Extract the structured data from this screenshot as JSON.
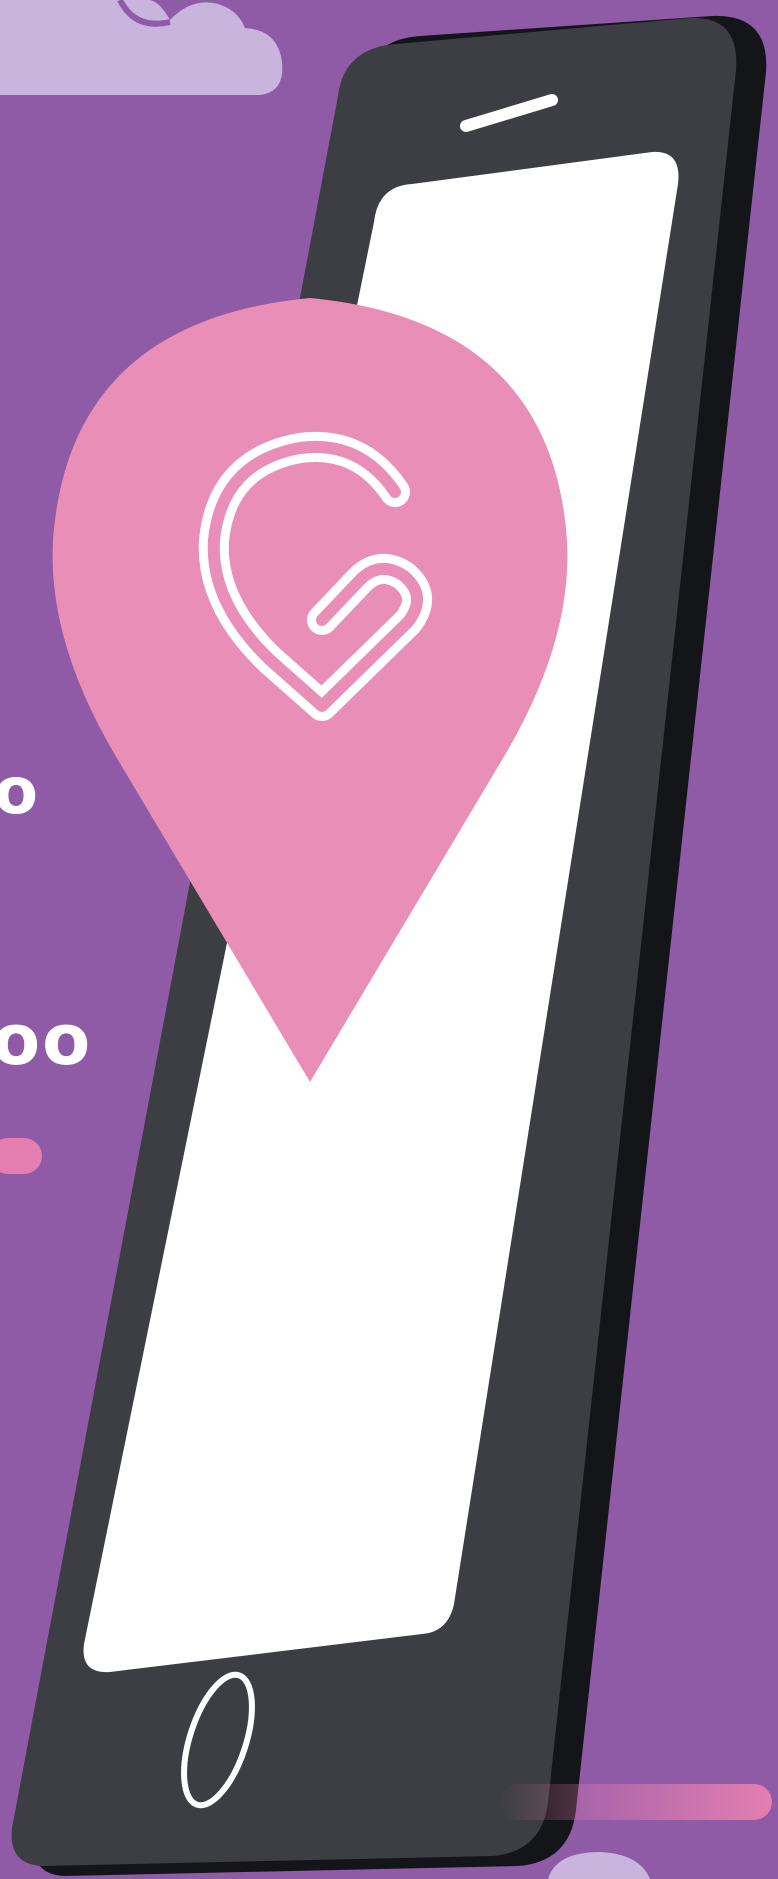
{
  "text_fragments": {
    "partial_top": "o",
    "partial_bottom": "oo"
  },
  "colors": {
    "background": "#8f5aa6",
    "cloud": "#c8b4dc",
    "phone_body": "#3d3e44",
    "phone_edge": "#141518",
    "screen": "#ffffff",
    "pin": "#e98fb7",
    "pin_logo": "#ffffff",
    "accent_pink": "#e47eb0"
  },
  "icons": {
    "pin": "map-pin-icon",
    "logo": "heart-c-logo-icon",
    "speaker": "earpiece-icon",
    "home": "home-button-icon"
  }
}
